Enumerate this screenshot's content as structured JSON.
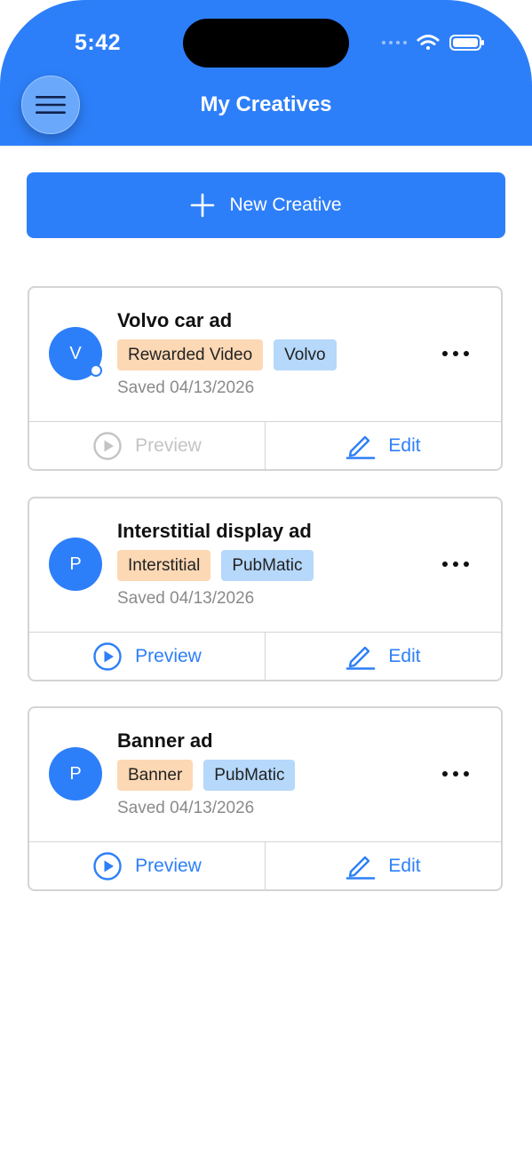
{
  "status_bar": {
    "time": "5:42"
  },
  "header": {
    "title": "My Creatives",
    "menu_icon": "hamburger-icon"
  },
  "new_creative": {
    "label": "New Creative",
    "icon": "plus-icon"
  },
  "colors": {
    "accent": "#2d7ff9",
    "type_tag": "#fdd8b5",
    "brand_tag": "#b6d8fb",
    "muted_text": "#8a8a8a",
    "disabled": "#c4c4c4"
  },
  "creatives": [
    {
      "avatar_letter": "V",
      "title": "Volvo car ad",
      "type_tag": "Rewarded Video",
      "brand_tag": "Volvo",
      "saved": "Saved 04/13/2026",
      "preview_label": "Preview",
      "preview_enabled": false,
      "edit_label": "Edit"
    },
    {
      "avatar_letter": "P",
      "title": "Interstitial display ad",
      "type_tag": "Interstitial",
      "brand_tag": "PubMatic",
      "saved": "Saved 04/13/2026",
      "preview_label": "Preview",
      "preview_enabled": true,
      "edit_label": "Edit"
    },
    {
      "avatar_letter": "P",
      "title": "Banner ad",
      "type_tag": "Banner",
      "brand_tag": "PubMatic",
      "saved": "Saved 04/13/2026",
      "preview_label": "Preview",
      "preview_enabled": true,
      "edit_label": "Edit"
    }
  ]
}
